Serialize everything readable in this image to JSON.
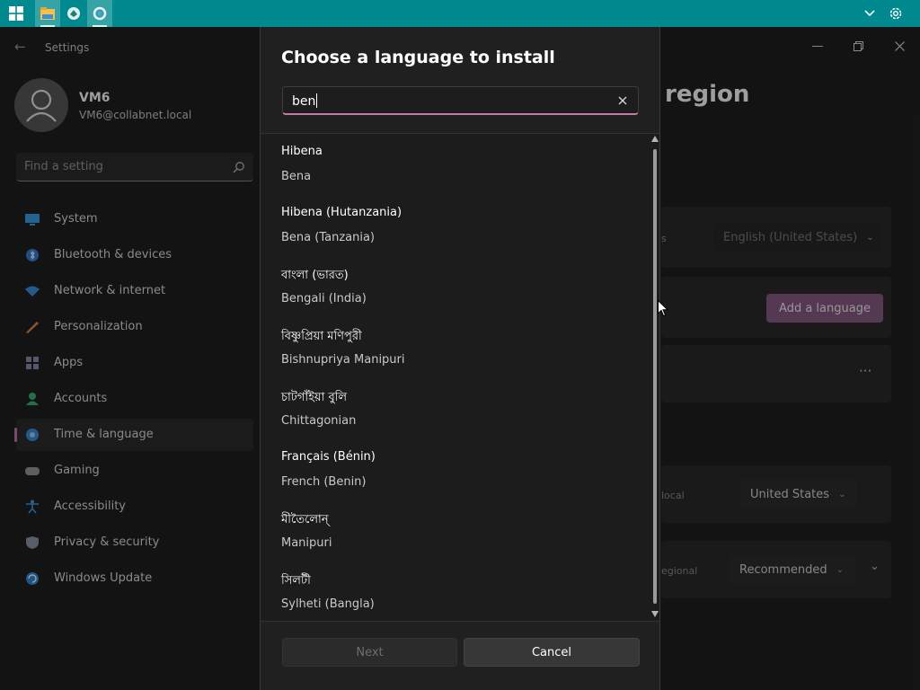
{
  "taskbar": {
    "icons": [
      "windows-start-icon",
      "file-explorer-icon",
      "app-icon",
      "settings-app-icon"
    ],
    "tray": [
      "chevron-up-icon",
      "gear-icon"
    ]
  },
  "settings_window": {
    "title": "Settings",
    "user": {
      "name": "VM6",
      "email": "VM6@collabnet.local"
    },
    "search": {
      "placeholder": "Find a setting"
    },
    "nav": [
      {
        "label": "System",
        "icon": "system-icon"
      },
      {
        "label": "Bluetooth & devices",
        "icon": "bluetooth-icon"
      },
      {
        "label": "Network & internet",
        "icon": "network-icon"
      },
      {
        "label": "Personalization",
        "icon": "personalization-icon"
      },
      {
        "label": "Apps",
        "icon": "apps-icon"
      },
      {
        "label": "Accounts",
        "icon": "accounts-icon"
      },
      {
        "label": "Time & language",
        "icon": "time-language-icon",
        "selected": true
      },
      {
        "label": "Gaming",
        "icon": "gaming-icon"
      },
      {
        "label": "Accessibility",
        "icon": "accessibility-icon"
      },
      {
        "label": "Privacy & security",
        "icon": "privacy-icon"
      },
      {
        "label": "Windows Update",
        "icon": "update-icon"
      }
    ],
    "page_title_partial": "region",
    "display_lang_label_partial": "s",
    "display_lang_value": "English (United States)",
    "add_language_label": "Add a language",
    "more_label": "···",
    "country_label_partial": "local",
    "country_value": "United States",
    "regional_label_partial": "egional",
    "regional_value": "Recommended"
  },
  "dialog": {
    "title": "Choose a language to install",
    "search_value": "ben",
    "results": [
      {
        "native": "Hibena",
        "english": "Bena"
      },
      {
        "native": "Hibena (Hutanzania)",
        "english": "Bena (Tanzania)"
      },
      {
        "native": "বাংলা (ভারত)",
        "english": "Bengali (India)"
      },
      {
        "native": "বিষ্ণুপ্রিয়া মণিপুরী",
        "english": "Bishnupriya Manipuri"
      },
      {
        "native": "চাটগাঁইয়া বুলি",
        "english": "Chittagonian"
      },
      {
        "native": "Français (Bénin)",
        "english": "French (Benin)"
      },
      {
        "native": "মীতৈলোন্",
        "english": "Manipuri"
      },
      {
        "native": "সিলটী",
        "english": "Sylheti (Bangla)"
      }
    ],
    "next_label": "Next",
    "cancel_label": "Cancel"
  },
  "colors": {
    "taskbar": "#00898f",
    "accent": "#c27aab",
    "add_language_button": "#8a5d86"
  }
}
